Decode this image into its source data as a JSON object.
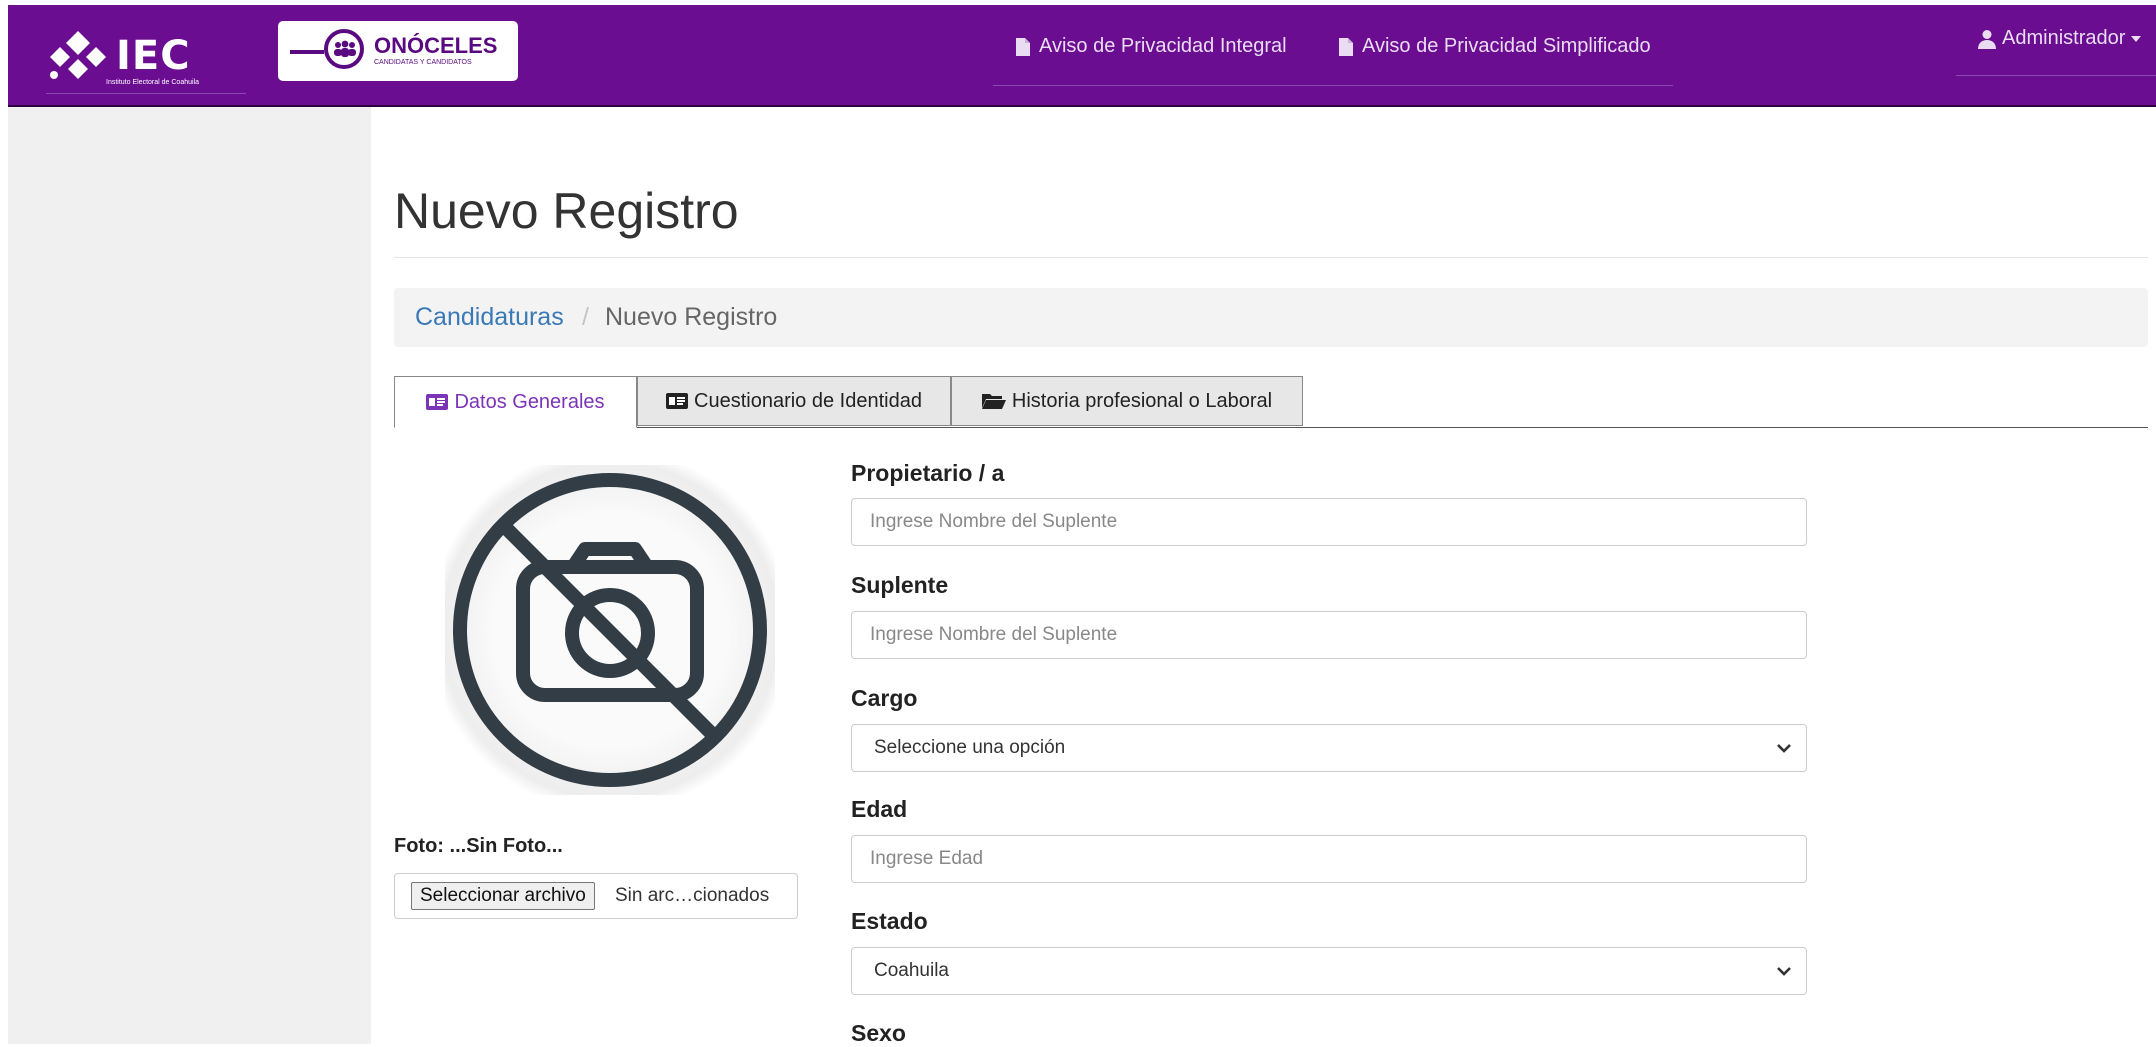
{
  "header": {
    "iec_logo": "IEC",
    "iec_subtitle": "Instituto Electoral de Coahuila",
    "app_logo": "ONÓCELES",
    "app_logo_subtitle": "CANDIDATAS Y CANDIDATOS",
    "nav": [
      {
        "label": "Aviso de Privacidad Integral",
        "icon": "document-icon"
      },
      {
        "label": "Aviso de Privacidad Simplificado",
        "icon": "document-icon"
      }
    ],
    "user": {
      "label": "Administrador",
      "icon": "user-icon",
      "caret": "caret-down-icon"
    }
  },
  "page": {
    "title": "Nuevo Registro"
  },
  "breadcrumb": {
    "items": [
      "Candidaturas",
      "Nuevo Registro"
    ],
    "separator": "/"
  },
  "tabs": [
    {
      "label": "Datos Generales",
      "icon": "id-card-icon",
      "active": true
    },
    {
      "label": "Cuestionario de Identidad",
      "icon": "id-card-icon",
      "active": false
    },
    {
      "label": "Historia profesional o Laboral",
      "icon": "folder-open-icon",
      "active": false
    }
  ],
  "photo": {
    "icon": "no-camera-icon",
    "label": "Foto: ...Sin Foto...",
    "file_button": "Seleccionar archivo",
    "file_status": "Sin arc…cionados"
  },
  "form": {
    "propietario": {
      "label": "Propietario / a",
      "placeholder": "Ingrese Nombre del Suplente",
      "value": ""
    },
    "suplente": {
      "label": "Suplente",
      "placeholder": "Ingrese Nombre del Suplente",
      "value": ""
    },
    "cargo": {
      "label": "Cargo",
      "selected": "Seleccione una opción"
    },
    "edad": {
      "label": "Edad",
      "placeholder": "Ingrese Edad",
      "value": ""
    },
    "estado": {
      "label": "Estado",
      "selected": "Coahuila"
    },
    "sexo": {
      "label": "Sexo"
    }
  },
  "colors": {
    "header_bg": "#6a0d91",
    "link": "#3a79b6",
    "active_tab": "#7c34b7",
    "icon_dark": "#333d45"
  }
}
